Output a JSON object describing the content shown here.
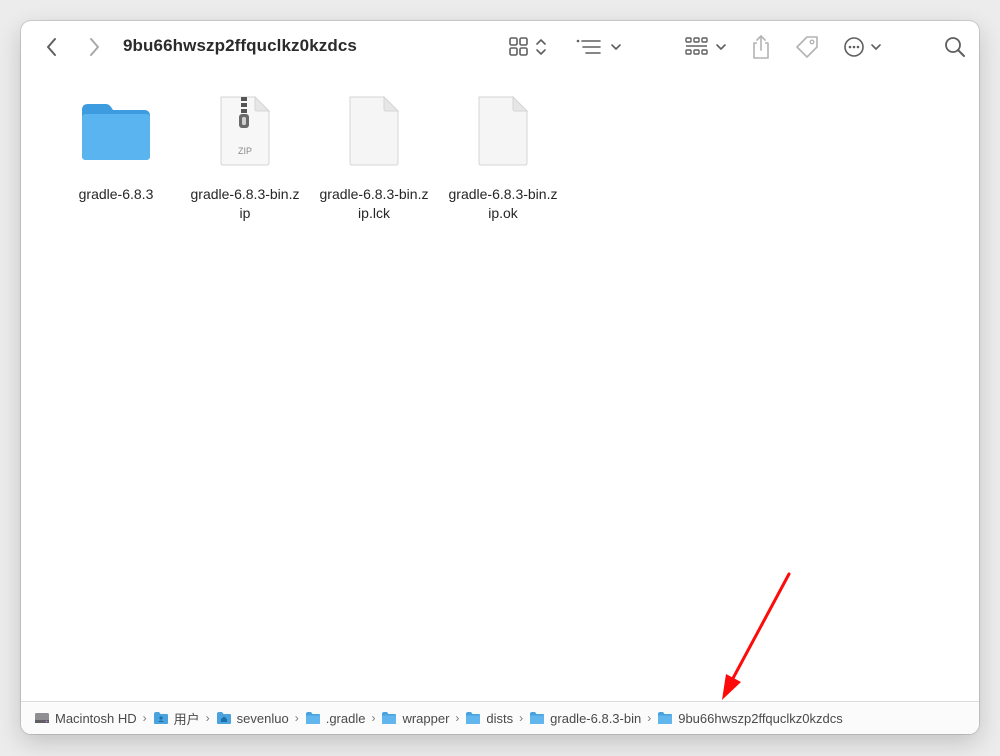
{
  "window": {
    "title": "9bu66hwszp2ffquclkz0kzdcs"
  },
  "toolbar": {
    "back_icon": "chevron-left-icon",
    "forward_icon": "chevron-right-icon",
    "view_icon": "icon-grid-icon",
    "list_icon": "list-view-icon",
    "group_icon": "group-icon",
    "share_icon": "share-icon",
    "tag_icon": "tag-icon",
    "more_icon": "ellipsis-circle-icon",
    "search_icon": "search-icon"
  },
  "files": [
    {
      "name": "gradle-6.8.3",
      "kind": "folder"
    },
    {
      "name": "gradle-6.8.3-bin.zip",
      "kind": "zip",
      "badge": "ZIP"
    },
    {
      "name": "gradle-6.8.3-bin.zip.lck",
      "kind": "document"
    },
    {
      "name": "gradle-6.8.3-bin.zip.ok",
      "kind": "document"
    }
  ],
  "pathbar": {
    "items": [
      {
        "label": "Macintosh HD",
        "icon": "hard-drive-icon"
      },
      {
        "label": "用户",
        "icon": "users-folder-icon"
      },
      {
        "label": "sevenluo",
        "icon": "home-folder-icon"
      },
      {
        "label": ".gradle",
        "icon": "folder-icon"
      },
      {
        "label": "wrapper",
        "icon": "folder-icon"
      },
      {
        "label": "dists",
        "icon": "folder-icon"
      },
      {
        "label": "gradle-6.8.3-bin",
        "icon": "folder-icon"
      },
      {
        "label": "9bu66hwszp2ffquclkz0kzdcs",
        "icon": "folder-icon"
      }
    ],
    "separator": "›"
  },
  "colors": {
    "folder": "#5ab4ef",
    "folder_tab": "#3d9be0",
    "annotation_arrow": "#ff0a0a"
  }
}
